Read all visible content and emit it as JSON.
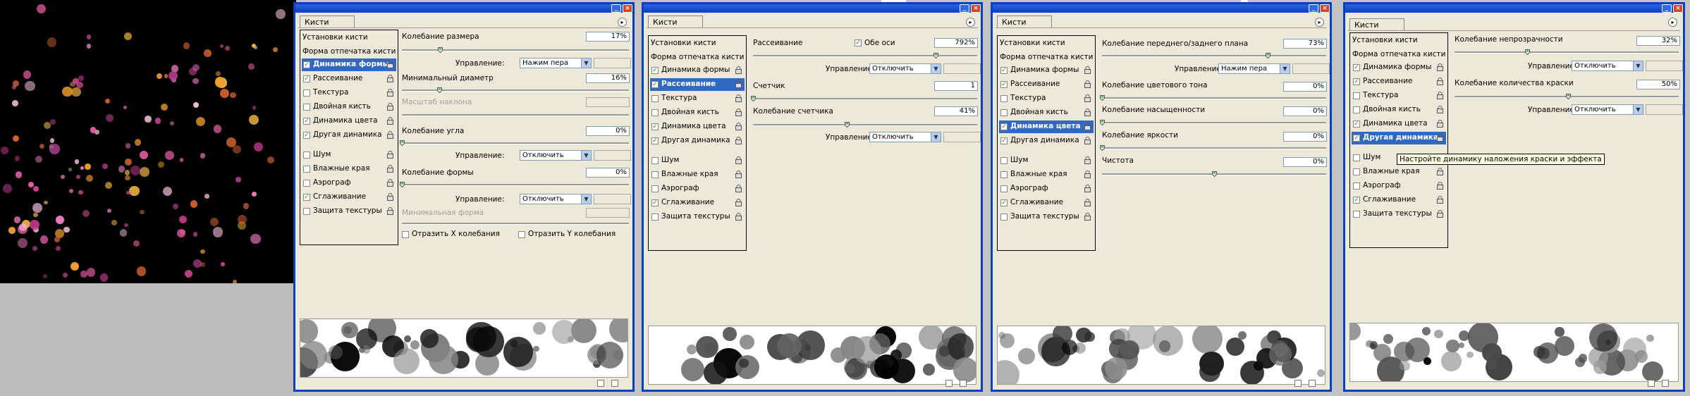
{
  "colors": {
    "title_blue": "#0a3fc4",
    "selection": "#316ac5",
    "panel_bg": "#ece9d8"
  },
  "panels": [
    {
      "tab": "Кисти",
      "presets_label": "Установки кисти",
      "tip_shape_label": "Форма отпечатка кисти",
      "list": [
        {
          "label": "Динамика формы",
          "checked": true,
          "selected": true
        },
        {
          "label": "Рассеивание",
          "checked": true,
          "selected": false
        },
        {
          "label": "Текстура",
          "checked": false,
          "selected": false
        },
        {
          "label": "Двойная кисть",
          "checked": false,
          "selected": false
        },
        {
          "label": "Динамика цвета",
          "checked": true,
          "selected": false
        },
        {
          "label": "Другая динамика",
          "checked": true,
          "selected": false
        },
        {
          "label": "Шум",
          "checked": false,
          "selected": false
        },
        {
          "label": "Влажные края",
          "checked": false,
          "selected": false
        },
        {
          "label": "Аэрограф",
          "checked": false,
          "selected": false
        },
        {
          "label": "Сглаживание",
          "checked": true,
          "selected": false
        },
        {
          "label": "Защита текстуры",
          "checked": false,
          "selected": false
        }
      ],
      "size_jitter_label": "Колебание размера",
      "size_jitter_value": "17%",
      "control_label": "Управление:",
      "control_size_value": "Нажим пера",
      "min_diameter_label": "Минимальный диаметр",
      "min_diameter_value": "16%",
      "tilt_scale_label": "Масштаб наклона",
      "angle_jitter_label": "Колебание угла",
      "angle_jitter_value": "0%",
      "control_angle_value": "Отключить",
      "roundness_jitter_label": "Колебание формы",
      "roundness_jitter_value": "0%",
      "control_round_value": "Отключить",
      "min_roundness_label": "Минимальная форма",
      "flip_x_label": "Отразить X колебания",
      "flip_y_label": "Отразить Y колебания"
    },
    {
      "tab": "Кисти",
      "presets_label": "Установки кисти",
      "tip_shape_label": "Форма отпечатка кисти",
      "list": [
        {
          "label": "Динамика формы",
          "checked": true,
          "selected": false
        },
        {
          "label": "Рассеивание",
          "checked": true,
          "selected": true
        },
        {
          "label": "Текстура",
          "checked": false,
          "selected": false
        },
        {
          "label": "Двойная кисть",
          "checked": false,
          "selected": false
        },
        {
          "label": "Динамика цвета",
          "checked": true,
          "selected": false
        },
        {
          "label": "Другая динамика",
          "checked": true,
          "selected": false
        },
        {
          "label": "Шум",
          "checked": false,
          "selected": false
        },
        {
          "label": "Влажные края",
          "checked": false,
          "selected": false
        },
        {
          "label": "Аэрограф",
          "checked": false,
          "selected": false
        },
        {
          "label": "Сглаживание",
          "checked": true,
          "selected": false
        },
        {
          "label": "Защита текстуры",
          "checked": false,
          "selected": false
        }
      ],
      "scatter_label": "Рассеивание",
      "both_axes_label": "Обе оси",
      "scatter_value": "792%",
      "control_label": "Управление:",
      "control_scatter_value": "Отключить",
      "count_label": "Счетчик",
      "count_value": "1",
      "count_jitter_label": "Колебание счетчика",
      "count_jitter_value": "41%",
      "control_count_value": "Отключить"
    },
    {
      "tab": "Кисти",
      "presets_label": "Установки кисти",
      "tip_shape_label": "Форма отпечатка кисти",
      "list": [
        {
          "label": "Динамика формы",
          "checked": true,
          "selected": false
        },
        {
          "label": "Рассеивание",
          "checked": true,
          "selected": false
        },
        {
          "label": "Текстура",
          "checked": false,
          "selected": false
        },
        {
          "label": "Двойная кисть",
          "checked": false,
          "selected": false
        },
        {
          "label": "Динамика цвета",
          "checked": true,
          "selected": true
        },
        {
          "label": "Другая динамика",
          "checked": true,
          "selected": false
        },
        {
          "label": "Шум",
          "checked": false,
          "selected": false
        },
        {
          "label": "Влажные края",
          "checked": false,
          "selected": false
        },
        {
          "label": "Аэрограф",
          "checked": false,
          "selected": false
        },
        {
          "label": "Сглаживание",
          "checked": true,
          "selected": false
        },
        {
          "label": "Защита текстуры",
          "checked": false,
          "selected": false
        }
      ],
      "fg_bg_jitter_label": "Колебание переднего/заднего плана",
      "fg_bg_jitter_value": "73%",
      "control_label": "Управление:",
      "control_fgbg_value": "Нажим пера",
      "hue_jitter_label": "Колебание цветового тона",
      "hue_jitter_value": "0%",
      "sat_jitter_label": "Колебание насыщенности",
      "sat_jitter_value": "0%",
      "bright_jitter_label": "Колебание яркости",
      "bright_jitter_value": "0%",
      "purity_label": "Чистота",
      "purity_value": "0%"
    },
    {
      "tab": "Кисти",
      "presets_label": "Установки кисти",
      "tip_shape_label": "Форма отпечатка кисти",
      "list": [
        {
          "label": "Динамика формы",
          "checked": true,
          "selected": false
        },
        {
          "label": "Рассеивание",
          "checked": true,
          "selected": false
        },
        {
          "label": "Текстура",
          "checked": false,
          "selected": false
        },
        {
          "label": "Двойная кисть",
          "checked": false,
          "selected": false
        },
        {
          "label": "Динамика цвета",
          "checked": true,
          "selected": false
        },
        {
          "label": "Другая динамика",
          "checked": true,
          "selected": true
        },
        {
          "label": "Шум",
          "checked": false,
          "selected": false
        },
        {
          "label": "Влажные края",
          "checked": false,
          "selected": false
        },
        {
          "label": "Аэрограф",
          "checked": false,
          "selected": false
        },
        {
          "label": "Сглаживание",
          "checked": true,
          "selected": false
        },
        {
          "label": "Защита текстуры",
          "checked": false,
          "selected": false
        }
      ],
      "opacity_jitter_label": "Колебание непрозрачности",
      "opacity_jitter_value": "32%",
      "control_label": "Управление:",
      "control_opacity_value": "Отключить",
      "flow_jitter_label": "Колебание количества краски",
      "flow_jitter_value": "50%",
      "control_flow_value": "Отключить",
      "tooltip": "Настройте динамику наложения краски и эффекта"
    }
  ]
}
